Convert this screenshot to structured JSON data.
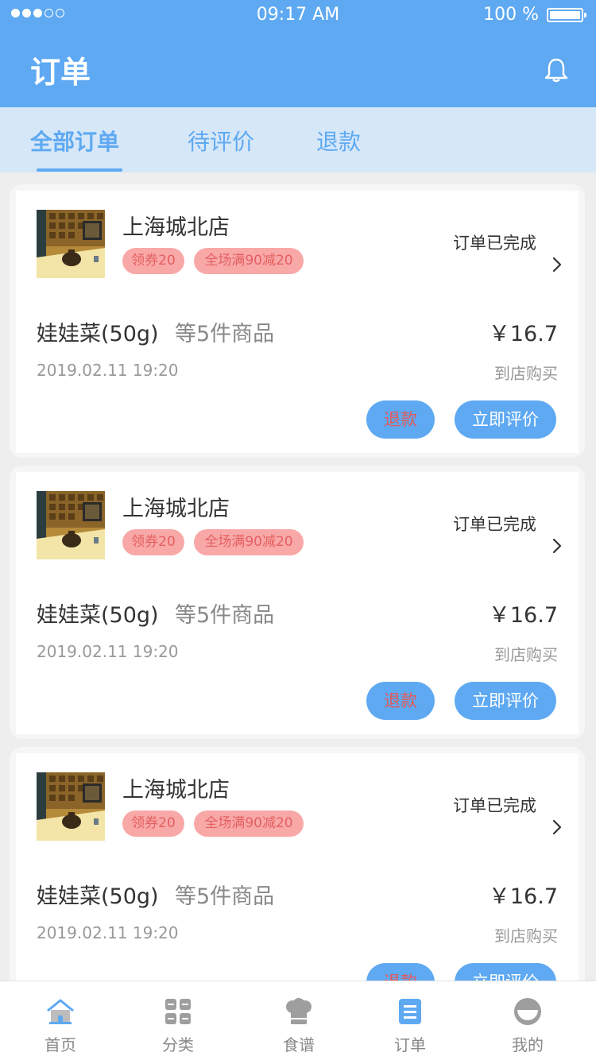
{
  "status_bar": {
    "time": "09:17 AM",
    "battery": "100 %"
  },
  "header": {
    "title": "订单"
  },
  "tabs": [
    {
      "label": "全部订单",
      "active": true
    },
    {
      "label": "待评价",
      "active": false
    },
    {
      "label": "退款",
      "active": false
    }
  ],
  "orders": [
    {
      "store": "上海城北店",
      "tags": [
        "领券20",
        "全场满90减20"
      ],
      "status": "订单已完成",
      "item": "娃娃菜(50g)",
      "more": "等5件商品",
      "price": "￥16.7",
      "date": "2019.02.11  19:20",
      "buy_type": "到店购买",
      "refund_label": "退款",
      "review_label": "立即评价"
    },
    {
      "store": "上海城北店",
      "tags": [
        "领券20",
        "全场满90减20"
      ],
      "status": "订单已完成",
      "item": "娃娃菜(50g)",
      "more": "等5件商品",
      "price": "￥16.7",
      "date": "2019.02.11  19:20",
      "buy_type": "到店购买",
      "refund_label": "退款",
      "review_label": "立即评价"
    },
    {
      "store": "上海城北店",
      "tags": [
        "领券20",
        "全场满90减20"
      ],
      "status": "订单已完成",
      "item": "娃娃菜(50g)",
      "more": "等5件商品",
      "price": "￥16.7",
      "date": "2019.02.11  19:20",
      "buy_type": "到店购买",
      "refund_label": "退款",
      "review_label": "立即评价"
    }
  ],
  "bottom_nav": [
    {
      "label": "首页",
      "icon": "home-icon",
      "active": false
    },
    {
      "label": "分类",
      "icon": "category-grid-icon",
      "active": false
    },
    {
      "label": "食谱",
      "icon": "chef-hat-icon",
      "active": false
    },
    {
      "label": "订单",
      "icon": "order-list-icon",
      "active": true
    },
    {
      "label": "我的",
      "icon": "profile-icon",
      "active": false
    }
  ],
  "colors": {
    "primary": "#5ea9f2",
    "tab_bg": "#d6e7f8",
    "tag_bg": "#f9a8a8",
    "tag_text": "#e46060",
    "refund_text": "#e05a5a"
  }
}
